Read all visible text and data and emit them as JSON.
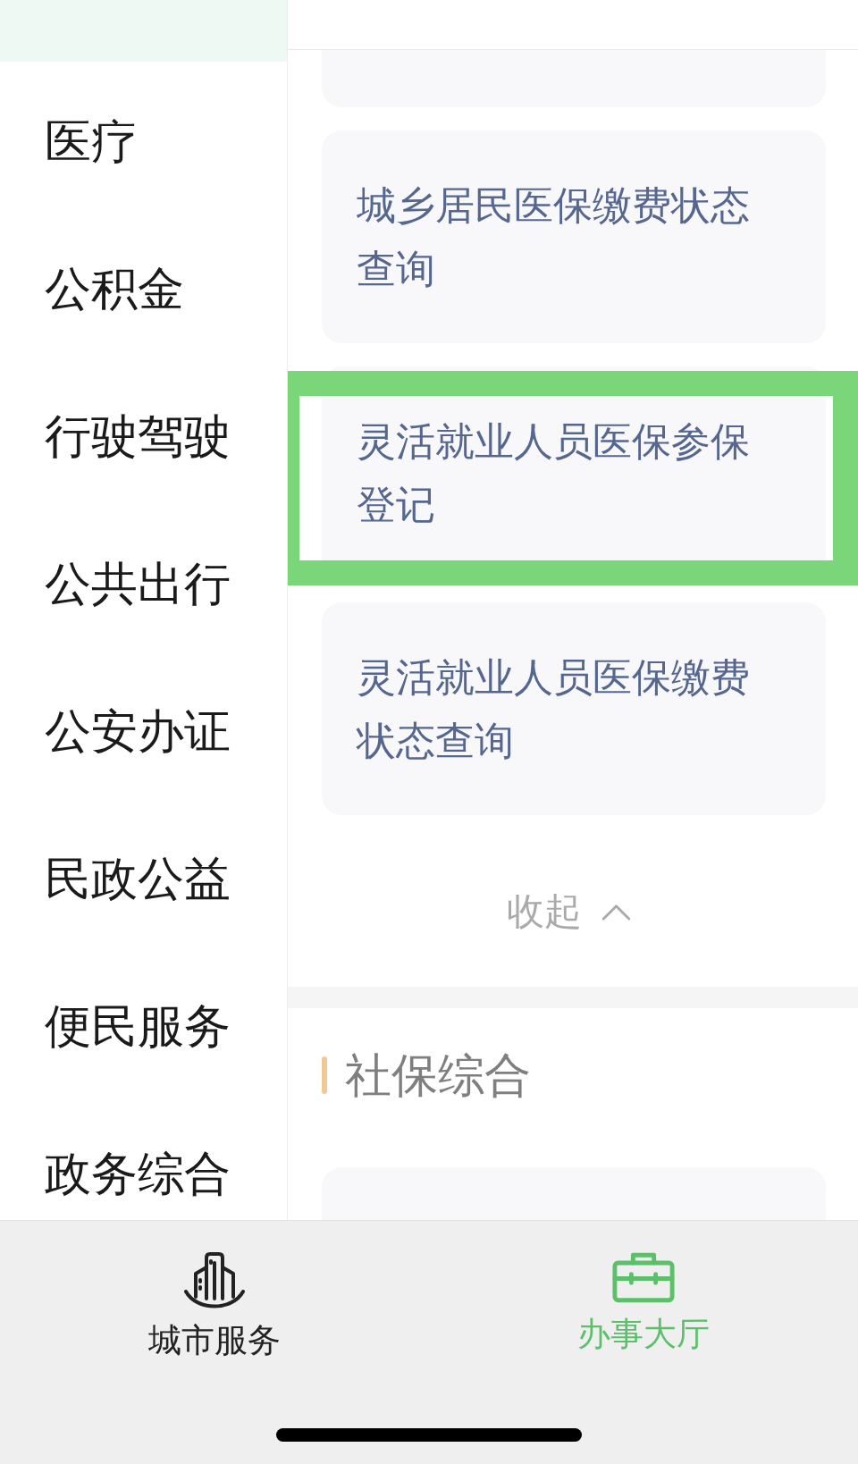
{
  "sidebar": {
    "items": [
      {
        "selected": true
      },
      {
        "label": "医疗",
        "selected": false
      },
      {
        "label": "公积金",
        "selected": false
      },
      {
        "label": "行驶驾驶",
        "selected": false
      },
      {
        "label": "公共出行",
        "selected": false
      },
      {
        "label": "公安办证",
        "selected": false
      },
      {
        "label": "民政公益",
        "selected": false
      },
      {
        "label": "便民服务",
        "selected": false
      },
      {
        "label": "政务综合",
        "selected": false
      }
    ]
  },
  "services": {
    "cards": [
      {
        "title": "城乡居民医保缴费状态查询",
        "highlighted": false
      },
      {
        "title": "灵活就业人员医保参保登记",
        "highlighted": true
      },
      {
        "title": "灵活就业人员医保缴费状态查询",
        "highlighted": false
      }
    ],
    "collapse_button": {
      "label": "收起"
    }
  },
  "section": {
    "title": "社保综合"
  },
  "tab_bar": {
    "tabs": [
      {
        "label": "城市服务",
        "selected": false
      },
      {
        "label": "办事大厅",
        "selected": true
      }
    ]
  }
}
